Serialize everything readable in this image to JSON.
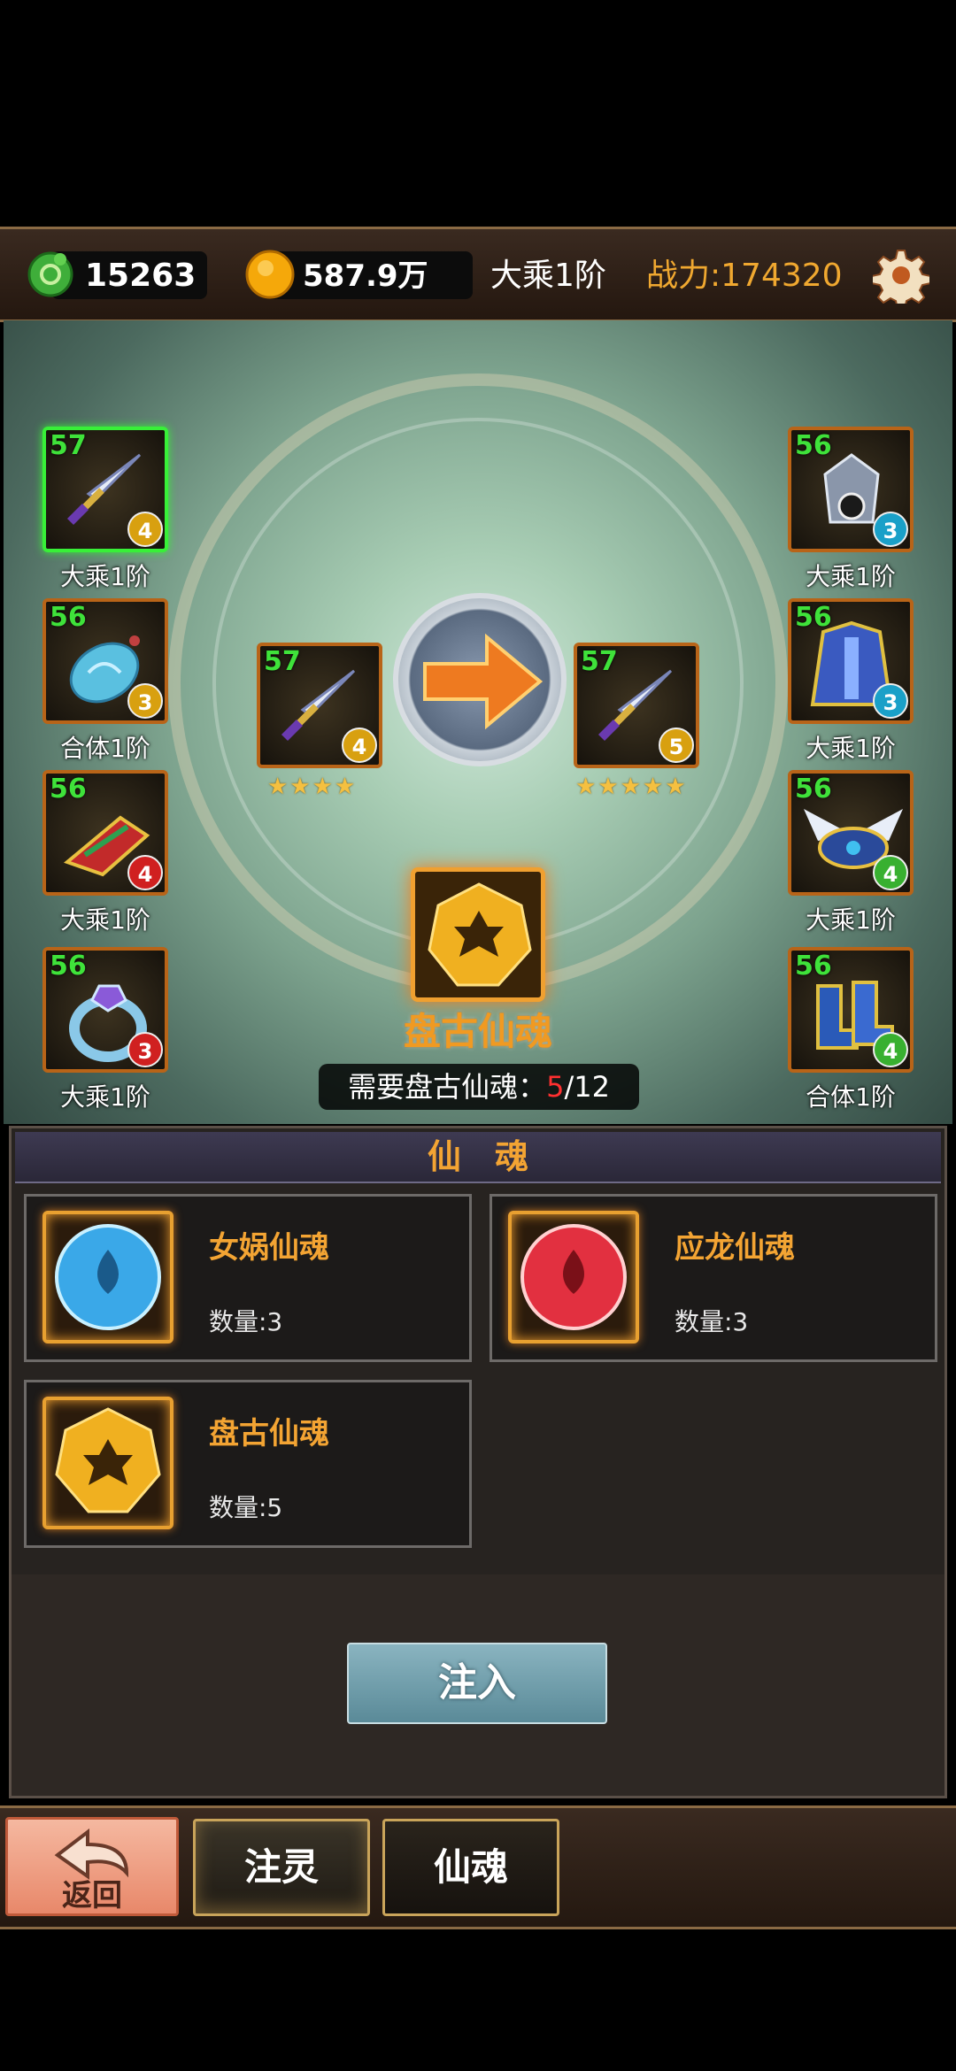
{
  "topbar": {
    "jade_count": "15263",
    "gold_amount": "587.9万",
    "realm": "大乘1阶",
    "power": "战力:174320",
    "jade_icon": "jade-coin-icon",
    "gold_icon": "gold-coin-icon",
    "settings_icon": "gear-icon"
  },
  "left_equipment": [
    {
      "level": "57",
      "badge": "4",
      "label": "大乘1阶",
      "icon": "sword-icon",
      "badge_color": "#d8a010",
      "selected": true
    },
    {
      "level": "56",
      "badge": "3",
      "label": "合体1阶",
      "icon": "jade-pendant-icon",
      "badge_color": "#d8a010"
    },
    {
      "level": "56",
      "badge": "4",
      "label": "大乘1阶",
      "icon": "bracer-icon",
      "badge_color": "#d02020"
    },
    {
      "level": "56",
      "badge": "3",
      "label": "大乘1阶",
      "icon": "ring-icon",
      "badge_color": "#d02020"
    }
  ],
  "right_equipment": [
    {
      "level": "56",
      "badge": "3",
      "label": "大乘1阶",
      "icon": "helmet-icon",
      "badge_color": "#1aa0c8"
    },
    {
      "level": "56",
      "badge": "3",
      "label": "大乘1阶",
      "icon": "armor-icon",
      "badge_color": "#1aa0c8"
    },
    {
      "level": "56",
      "badge": "4",
      "label": "大乘1阶",
      "icon": "winged-belt-icon",
      "badge_color": "#38b030"
    },
    {
      "level": "56",
      "badge": "4",
      "label": "合体1阶",
      "icon": "boots-icon",
      "badge_color": "#38b030"
    }
  ],
  "upgrade": {
    "current": {
      "level": "57",
      "badge": "4",
      "stars": "★★★★",
      "icon": "sword-icon"
    },
    "next": {
      "level": "57",
      "badge": "5",
      "stars": "★★★★★",
      "icon": "sword-icon"
    },
    "arrow_icon": "arrow-right-icon",
    "material_name": "盘古仙魂",
    "material_icon": "pangu-soul-gem-icon",
    "requirement_prefix": "需要盘古仙魂：",
    "requirement_have": "5",
    "requirement_sep": "/",
    "requirement_need": "12"
  },
  "panel": {
    "title": "仙　魂",
    "souls": [
      {
        "name": "女娲仙魂",
        "qty": "数量:3",
        "icon": "nuwa-soul-gem-icon",
        "color": "#3aa8e8"
      },
      {
        "name": "应龙仙魂",
        "qty": "数量:3",
        "icon": "yinglong-soul-gem-icon",
        "color": "#e23040"
      },
      {
        "name": "盘古仙魂",
        "qty": "数量:5",
        "icon": "pangu-soul-gem-icon",
        "color": "#f0b020"
      }
    ],
    "inject_label": "注入"
  },
  "bottombar": {
    "back_label": "返回",
    "back_icon": "back-arrow-icon",
    "tabs": [
      "注灵",
      "仙魂"
    ]
  }
}
